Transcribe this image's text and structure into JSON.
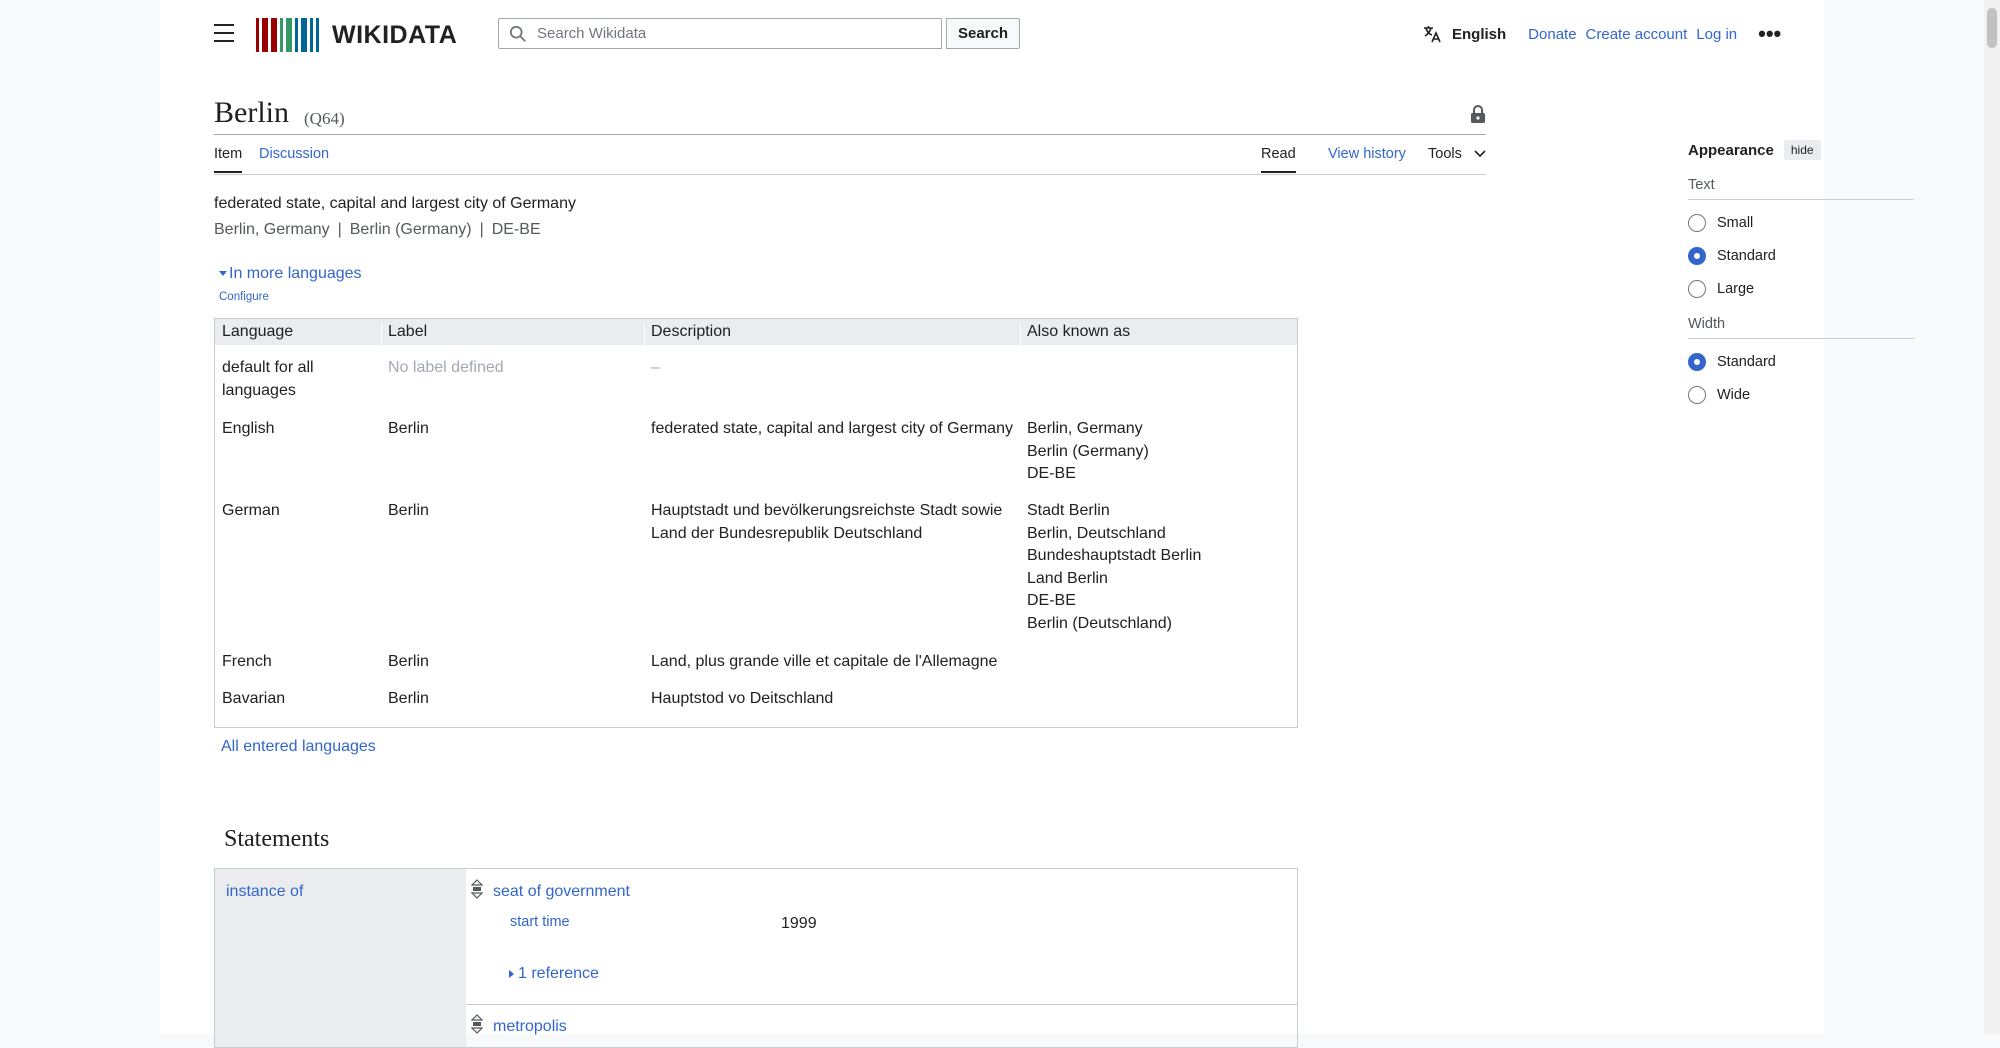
{
  "header": {
    "logo_text": "WIKIDATA",
    "search_placeholder": "Search Wikidata",
    "search_button": "Search",
    "language": "English",
    "donate": "Donate",
    "create_account": "Create account",
    "log_in": "Log in",
    "more": "•••"
  },
  "item": {
    "title": "Berlin",
    "qid": "(Q64)",
    "tabs": {
      "item": "Item",
      "discussion": "Discussion",
      "read": "Read",
      "view_history": "View history",
      "tools": "Tools"
    },
    "description": "federated state, capital and largest city of Germany",
    "aliases": [
      "Berlin, Germany",
      "Berlin (Germany)",
      "DE-BE"
    ],
    "alias_separator": "|",
    "more_languages": "In more languages",
    "configure": "Configure"
  },
  "languages_table": {
    "headers": [
      "Language",
      "Label",
      "Description",
      "Also known as"
    ],
    "rows": [
      {
        "language": "default for all languages",
        "label": "No label defined",
        "description": "–",
        "aliases": []
      },
      {
        "language": "English",
        "label": "Berlin",
        "description": "federated state, capital and largest city of Germany",
        "aliases": [
          "Berlin, Germany",
          "Berlin (Germany)",
          "DE-BE"
        ]
      },
      {
        "language": "German",
        "label": "Berlin",
        "description": "Hauptstadt und bevölkerungsreichste Stadt sowie Land der Bundesrepublik Deutschland",
        "aliases": [
          "Stadt Berlin",
          "Berlin, Deutschland",
          "Bundeshauptstadt Berlin",
          "Land Berlin",
          "DE-BE",
          "Berlin (Deutschland)"
        ]
      },
      {
        "language": "French",
        "label": "Berlin",
        "description": "Land, plus grande ville et capitale de l'Allemagne",
        "aliases": []
      },
      {
        "language": "Bavarian",
        "label": "Berlin",
        "description": "Hauptstod vo Deitschland",
        "aliases": []
      }
    ],
    "all_entered": "All entered languages"
  },
  "statements": {
    "heading": "Statements",
    "property": "instance of",
    "values": [
      {
        "value": "seat of government",
        "qualifier_property": "start time",
        "qualifier_value": "1999",
        "reference": "1 reference"
      },
      {
        "value": "metropolis"
      }
    ]
  },
  "appearance": {
    "title": "Appearance",
    "hide": "hide",
    "text_label": "Text",
    "text_options": [
      "Small",
      "Standard",
      "Large"
    ],
    "text_selected": "Standard",
    "width_label": "Width",
    "width_options": [
      "Standard",
      "Wide"
    ],
    "width_selected": "Standard"
  },
  "colors": {
    "link": "#3366cc",
    "text": "#202122",
    "border": "#c8ccd1",
    "header_bg": "#eaecf0"
  },
  "icons": [
    "menu-icon",
    "search-icon",
    "translate-icon",
    "lock-icon",
    "chevron-down-icon",
    "rank-icon"
  ]
}
